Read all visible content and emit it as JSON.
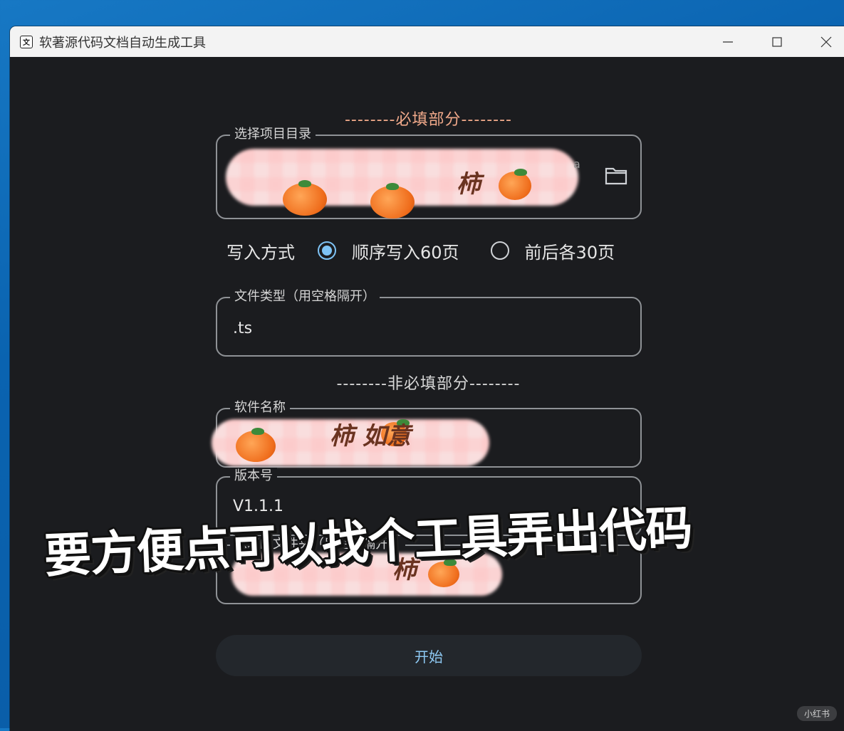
{
  "window": {
    "title": "软著源代码文档自动生成工具",
    "icon_label": "文"
  },
  "sections": {
    "required_title": "--------必填部分--------",
    "optional_title": "--------非必填部分--------"
  },
  "fields": {
    "project_dir": {
      "label": "选择项目目录",
      "value_prefix": "C",
      "value_suffix": "a"
    },
    "write_mode": {
      "label": "写入方式",
      "options": [
        {
          "label": "顺序写入60页",
          "checked": true
        },
        {
          "label": "前后各30页",
          "checked": false
        }
      ]
    },
    "file_types": {
      "label": "文件类型（用空格隔开）",
      "value": ".ts"
    },
    "software_name": {
      "label": "软件名称"
    },
    "version": {
      "label": "版本号",
      "value": "V1.1.1"
    },
    "ignored_dirs": {
      "label": "忽略的文件夹（用空格隔开）",
      "value_prefix": "t"
    }
  },
  "start_button": {
    "label": "开始"
  },
  "overlay": {
    "caption": "要方便点可以找个工具弄出代码",
    "watermark": "小红书",
    "scribble_1": "柿",
    "scribble_2": "柿  如意",
    "scribble_3": "柿"
  },
  "colors": {
    "accent": "#7ec3f5",
    "required_title": "#f0a98a",
    "background": "#1b1c1f"
  },
  "icons": [
    "app-icon",
    "minimize-icon",
    "maximize-icon",
    "close-icon",
    "folder-icon"
  ]
}
